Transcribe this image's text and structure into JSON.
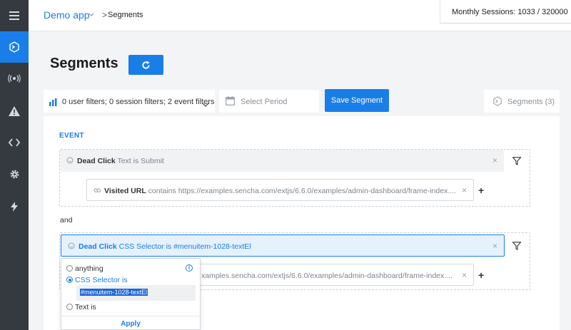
{
  "header": {
    "app_name": "Demo app",
    "breadcrumb_sep": ">",
    "breadcrumb_current": "Segments",
    "sessions": "Monthly Sessions: 1033 / 320000"
  },
  "page": {
    "title": "Segments"
  },
  "toolbar": {
    "filters_summary": "0 user filters; 0 session filters; 2 event filters",
    "period_placeholder": "Select Period",
    "save_label": "Save Segment",
    "segments_label": "Segments (3)"
  },
  "event_section": {
    "label": "EVENT",
    "and_label": "and",
    "group1": {
      "type": "Dead Click",
      "attr": "Text",
      "op": "is",
      "value": "Submit",
      "sub_type": "Visited URL",
      "sub_op": "contains",
      "sub_value": "https://examples.sencha.com/extjs/6.6.0/examples/admin-dashboard/frame-index...."
    },
    "group2": {
      "type": "Dead Click",
      "attr": "CSS Selector",
      "op": "is",
      "value": "#menuitem-1028-textEl",
      "sub_value_visible": "xamples.sencha.com/extjs/6.6.0/examples/admin-dashboard/frame-index...."
    }
  },
  "popup": {
    "opt_anything": "anything",
    "opt_css": "CSS Selector is",
    "css_value": "#menuitem-1028-textEl",
    "opt_text": "Text is",
    "apply": "Apply",
    "info": "i"
  },
  "icons": {
    "close": "×",
    "plus": "+"
  },
  "colors": {
    "accent": "#1a7ee8",
    "sidebar": "#343a40",
    "highlight_row": "#e5f1fc"
  }
}
